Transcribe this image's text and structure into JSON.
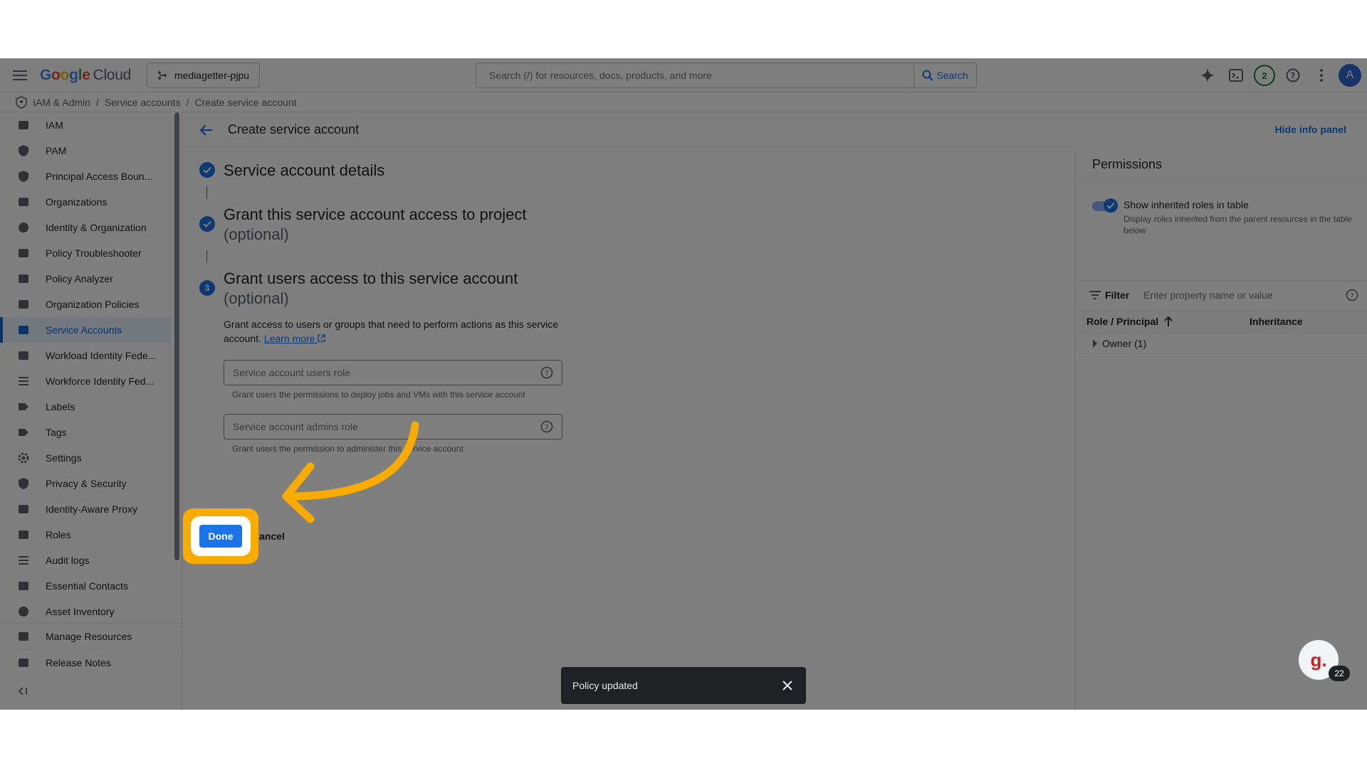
{
  "topbar": {
    "logo_parts": [
      "G",
      "o",
      "o",
      "g",
      "l",
      "e"
    ],
    "logo_suffix": "Cloud",
    "project": "mediagetter-pjpu",
    "search_placeholder": "Search (/) for resources, docs, products, and more",
    "search_button": "Search",
    "notifications_count": "2",
    "avatar_initial": "A"
  },
  "breadcrumb": {
    "items": [
      "IAM & Admin",
      "Service accounts",
      "Create service account"
    ],
    "separator": "/"
  },
  "sidebar": {
    "items": [
      {
        "label": "IAM",
        "icon": "person-add-icon"
      },
      {
        "label": "PAM",
        "icon": "shield-icon"
      },
      {
        "label": "Principal Access Boun...",
        "icon": "shield-lock-icon"
      },
      {
        "label": "Organizations",
        "icon": "building-icon"
      },
      {
        "label": "Identity & Organization",
        "icon": "account-circle-icon"
      },
      {
        "label": "Policy Troubleshooter",
        "icon": "wrench-icon"
      },
      {
        "label": "Policy Analyzer",
        "icon": "document-search-icon"
      },
      {
        "label": "Organization Policies",
        "icon": "list-box-icon"
      },
      {
        "label": "Service Accounts",
        "icon": "service-account-icon"
      },
      {
        "label": "Workload Identity Fede...",
        "icon": "id-card-icon"
      },
      {
        "label": "Workforce Identity Fed...",
        "icon": "list-icon"
      },
      {
        "label": "Labels",
        "icon": "label-icon"
      },
      {
        "label": "Tags",
        "icon": "tag-icon"
      },
      {
        "label": "Settings",
        "icon": "gear-icon"
      },
      {
        "label": "Privacy & Security",
        "icon": "privacy-shield-icon"
      },
      {
        "label": "Identity-Aware Proxy",
        "icon": "proxy-icon"
      },
      {
        "label": "Roles",
        "icon": "roles-icon"
      },
      {
        "label": "Audit logs",
        "icon": "lines-icon"
      },
      {
        "label": "Essential Contacts",
        "icon": "contacts-icon"
      },
      {
        "label": "Asset Inventory",
        "icon": "diamond-icon"
      }
    ],
    "active_index": 8,
    "bottom_items": [
      {
        "label": "Manage Resources",
        "icon": "folder-gear-icon"
      },
      {
        "label": "Release Notes",
        "icon": "notes-icon"
      }
    ]
  },
  "main": {
    "title": "Create service account",
    "hide_info_panel": "Hide info panel",
    "steps": [
      {
        "title": "Service account details",
        "subtitle": "",
        "status": "complete"
      },
      {
        "title": "Grant this service account access to project",
        "subtitle": "(optional)",
        "status": "complete"
      },
      {
        "title": "Grant users access to this service account",
        "subtitle": "(optional)",
        "status": "active",
        "number": "3"
      }
    ],
    "step3_description": "Grant access to users or groups that need to perform actions as this service account.",
    "learn_more": "Learn more",
    "users_role_placeholder": "Service account users role",
    "users_role_hint": "Grant users the permissions to deploy jobs and VMs with this service account",
    "admins_role_placeholder": "Service account admins role",
    "admins_role_hint": "Grant users the permission to administer this service account",
    "done_button": "Done",
    "cancel_button": "Cancel"
  },
  "info_panel": {
    "title": "Permissions",
    "toggle_label": "Show inherited roles in table",
    "toggle_description": "Display roles inherited from the parent resources in the table below",
    "toggle_on": true,
    "filter_label": "Filter",
    "filter_placeholder": "Enter property name or value",
    "columns": [
      "Role / Principal",
      "Inheritance"
    ],
    "rows": [
      {
        "label": "Owner (1)"
      }
    ]
  },
  "toast": {
    "message": "Policy updated"
  },
  "widget": {
    "letter": "g.",
    "badge": "22"
  },
  "colors": {
    "accent": "#1a73e8",
    "highlight": "#f9ab00"
  }
}
